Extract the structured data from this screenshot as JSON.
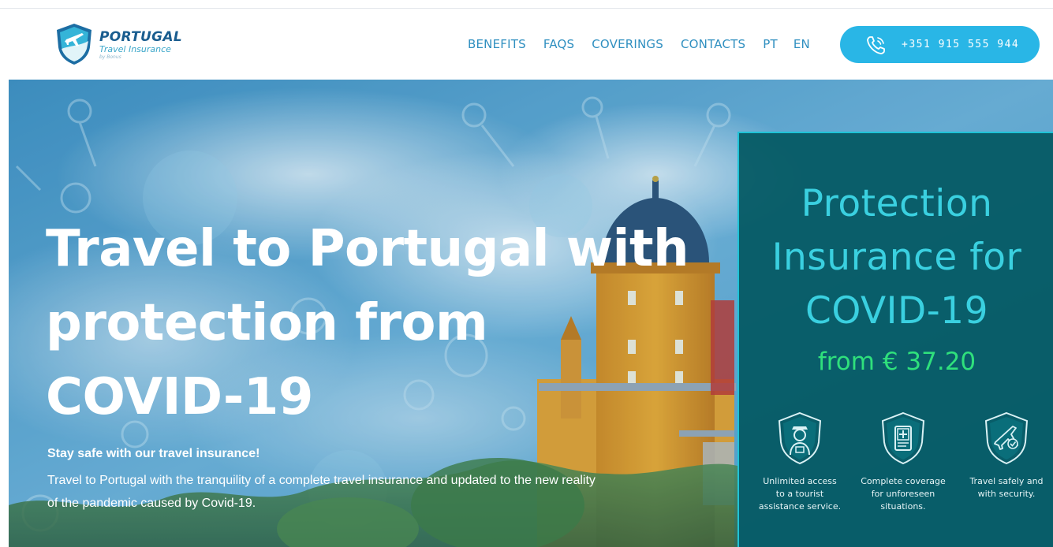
{
  "brand": {
    "title": "PORTUGAL",
    "subtitle": "Travel Insurance",
    "by": "by Bonus",
    "primary_color": "#1a5d8f",
    "accent_color": "#29b6e6"
  },
  "nav": {
    "items": [
      {
        "label": "BENEFITS"
      },
      {
        "label": "FAQS"
      },
      {
        "label": "COVERINGS"
      },
      {
        "label": "CONTACTS"
      }
    ],
    "languages": [
      {
        "label": "PT"
      },
      {
        "label": "EN"
      }
    ]
  },
  "phone": {
    "icon": "phone-icon",
    "number": "+351 915 555 944"
  },
  "hero": {
    "title_lines": [
      "Travel to Portugal with",
      "protection from",
      "COVID-19"
    ],
    "lead": "Stay safe with our travel insurance!",
    "text_lines": [
      "Travel to Portugal with the tranquility of a complete travel insurance and updated to the new reality",
      "of the pandemic caused by Covid-19."
    ]
  },
  "panel": {
    "title_lines": [
      "Protection",
      "Insurance for",
      "COVID-19"
    ],
    "price": "from € 37.20",
    "title_color": "#3ad0e0",
    "price_color": "#2fe07c",
    "features": [
      {
        "icon": "tourist-assistant-icon",
        "lines": [
          "Unlimited access",
          "to a tourist",
          "assistance service."
        ]
      },
      {
        "icon": "medical-coverage-icon",
        "lines": [
          "Complete coverage",
          "for unforeseen",
          "situations."
        ]
      },
      {
        "icon": "secure-travel-icon",
        "lines": [
          "Travel safely and",
          "with security."
        ]
      }
    ]
  }
}
